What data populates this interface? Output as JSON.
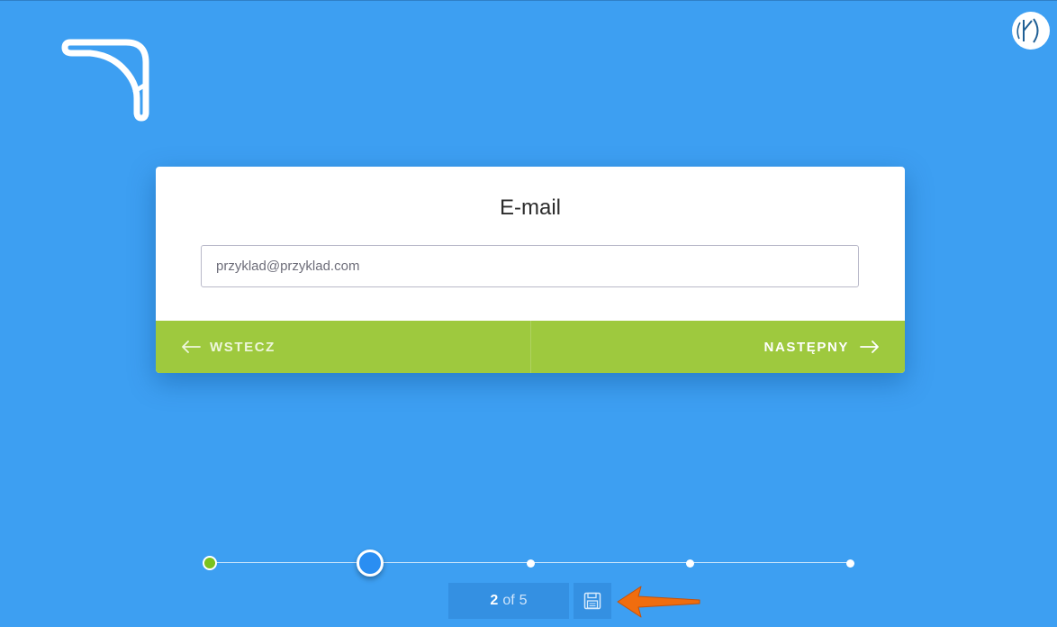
{
  "logo": {
    "icon": "boomerang-logo"
  },
  "corner": {
    "icon": "brand-badge-icon"
  },
  "card": {
    "title": "E-mail",
    "email_placeholder": "przyklad@przyklad.com",
    "email_value": ""
  },
  "actions": {
    "back_label": "WSTECZ",
    "next_label": "NASTĘPNY"
  },
  "progress": {
    "current": "2",
    "of_label": "of",
    "total": "5",
    "completed_steps": 1,
    "current_step": 2,
    "total_steps": 5
  },
  "colors": {
    "background": "#3d9ff2",
    "action_bar": "#9ec93e",
    "step_done": "#7ac21e",
    "step_current": "#2a8ef2",
    "pointer": "#f06d0e"
  }
}
